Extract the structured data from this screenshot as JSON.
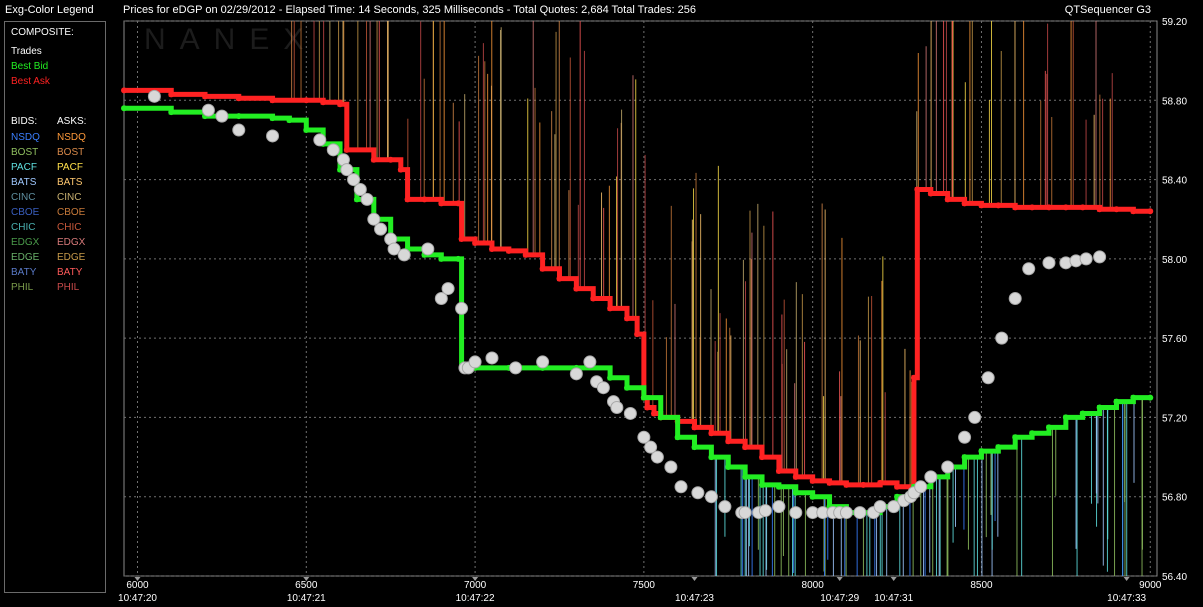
{
  "header": {
    "legend_title": "Exg-Color Legend",
    "chart_title": "Prices for  eDGP  on  02/29/2012  -  Elapsed Time: 14 Seconds, 325 Milliseconds  -  Total Quotes: 2,684  Total Trades: 256",
    "app_name": "QTSequencer G3"
  },
  "legend": {
    "composite_label": "COMPOSITE:",
    "composite": [
      {
        "label": "Trades",
        "color": "#ffffff"
      },
      {
        "label": "Best Bid",
        "color": "#22ee22"
      },
      {
        "label": "Best Ask",
        "color": "#ff2222"
      }
    ],
    "bids_label": "BIDS:",
    "asks_label": "ASKS:",
    "exchanges": [
      {
        "name": "NSDQ",
        "bid_color": "#3a7fff",
        "ask_color": "#ff9a3a"
      },
      {
        "name": "BOST",
        "bid_color": "#8fbf5f",
        "ask_color": "#d98a4a"
      },
      {
        "name": "PACF",
        "bid_color": "#5fe0e0",
        "ask_color": "#ffe04a"
      },
      {
        "name": "BATS",
        "bid_color": "#9fc8ff",
        "ask_color": "#ffc870"
      },
      {
        "name": "CINC",
        "bid_color": "#5f8fa0",
        "ask_color": "#c8b070"
      },
      {
        "name": "CBOE",
        "bid_color": "#3a5fc0",
        "ask_color": "#c87a3a"
      },
      {
        "name": "CHIC",
        "bid_color": "#4ab0b0",
        "ask_color": "#c8583a"
      },
      {
        "name": "EDGX",
        "bid_color": "#4a9a4a",
        "ask_color": "#d87a7a"
      },
      {
        "name": "EDGE",
        "bid_color": "#6ab06a",
        "ask_color": "#c89a4a"
      },
      {
        "name": "BATY",
        "bid_color": "#5a7ac8",
        "ask_color": "#ff5a5a"
      },
      {
        "name": "PHIL",
        "bid_color": "#7a9a4a",
        "ask_color": "#c84a4a"
      }
    ]
  },
  "watermark": "NANEX",
  "colors": {
    "background": "#000000",
    "grid": "#707070",
    "frame": "#8a8a8a",
    "trades": "#d8d8d8",
    "best_bid": "#22ee22",
    "best_ask": "#ff2222"
  },
  "chart_data": {
    "type": "line",
    "ylim": [
      56.4,
      59.2
    ],
    "y_ticks": [
      "59.20",
      "58.80",
      "58.40",
      "58.00",
      "57.60",
      "57.20",
      "56.80",
      "56.40"
    ],
    "xlim": [
      5960,
      9020
    ],
    "x_ticks": [
      "6000",
      "6500",
      "7000",
      "7500",
      "8000",
      "8500",
      "9000"
    ],
    "time_labels": [
      {
        "seq": 6000,
        "label": "10:47:20"
      },
      {
        "seq": 6500,
        "label": "10:47:21"
      },
      {
        "seq": 7000,
        "label": "10:47:22"
      },
      {
        "seq": 7650,
        "label": "10:47:23"
      },
      {
        "seq": 8080,
        "label": "10:47:29"
      },
      {
        "seq": 8240,
        "label": "10:47:31"
      },
      {
        "seq": 8930,
        "label": "10:47:33"
      }
    ],
    "series": [
      {
        "name": "Best Ask",
        "x": [
          5960,
          6100,
          6200,
          6300,
          6400,
          6500,
          6550,
          6600,
          6620,
          6700,
          6750,
          6780,
          6800,
          6850,
          6900,
          6950,
          6960,
          7000,
          7050,
          7100,
          7150,
          7200,
          7250,
          7300,
          7350,
          7400,
          7450,
          7480,
          7500,
          7510,
          7530,
          7550,
          7600,
          7650,
          7700,
          7750,
          7800,
          7850,
          7900,
          7950,
          8000,
          8050,
          8100,
          8150,
          8200,
          8250,
          8300,
          8310,
          8350,
          8400,
          8450,
          8500,
          8550,
          8600,
          8650,
          8700,
          8750,
          8800,
          8850,
          8900,
          8950,
          9000
        ],
        "y": [
          58.85,
          58.83,
          58.82,
          58.81,
          58.8,
          58.8,
          58.79,
          58.78,
          58.55,
          58.5,
          58.5,
          58.45,
          58.3,
          58.3,
          58.28,
          58.28,
          58.1,
          58.08,
          58.05,
          58.04,
          58.02,
          57.95,
          57.9,
          57.85,
          57.8,
          57.75,
          57.7,
          57.62,
          57.3,
          57.25,
          57.22,
          57.2,
          57.18,
          57.15,
          57.12,
          57.08,
          57.05,
          57.0,
          56.93,
          56.9,
          56.88,
          56.87,
          56.86,
          56.86,
          56.87,
          56.85,
          57.4,
          58.35,
          58.33,
          58.3,
          58.28,
          58.27,
          58.27,
          58.26,
          58.26,
          58.26,
          58.26,
          58.26,
          58.25,
          58.25,
          58.24,
          58.24
        ]
      },
      {
        "name": "Best Bid",
        "x": [
          5960,
          6100,
          6200,
          6300,
          6400,
          6450,
          6500,
          6550,
          6600,
          6650,
          6700,
          6750,
          6800,
          6850,
          6900,
          6950,
          6960,
          7000,
          7100,
          7200,
          7300,
          7400,
          7450,
          7500,
          7550,
          7600,
          7650,
          7700,
          7750,
          7800,
          7850,
          7900,
          7950,
          8000,
          8050,
          8100,
          8150,
          8200,
          8250,
          8300,
          8350,
          8400,
          8450,
          8500,
          8550,
          8600,
          8650,
          8700,
          8750,
          8800,
          8850,
          8900,
          8950,
          9000
        ],
        "y": [
          58.76,
          58.74,
          58.72,
          58.72,
          58.71,
          58.7,
          58.65,
          58.58,
          58.45,
          58.3,
          58.2,
          58.1,
          58.05,
          58.02,
          58.0,
          58.0,
          57.45,
          57.45,
          57.45,
          57.45,
          57.45,
          57.4,
          57.35,
          57.3,
          57.2,
          57.1,
          57.05,
          57.0,
          56.95,
          56.9,
          56.86,
          56.85,
          56.82,
          56.8,
          56.75,
          56.72,
          56.72,
          56.75,
          56.8,
          56.85,
          56.9,
          56.95,
          57.0,
          57.03,
          57.05,
          57.1,
          57.12,
          57.15,
          57.2,
          57.22,
          57.25,
          57.28,
          57.3,
          57.3
        ]
      },
      {
        "name": "Trades",
        "x": [
          6050,
          6210,
          6250,
          6300,
          6400,
          6540,
          6580,
          6610,
          6620,
          6640,
          6660,
          6680,
          6700,
          6720,
          6750,
          6760,
          6790,
          6860,
          6900,
          6920,
          6960,
          6970,
          6980,
          7000,
          7050,
          7120,
          7200,
          7300,
          7340,
          7360,
          7380,
          7410,
          7420,
          7460,
          7500,
          7520,
          7540,
          7580,
          7610,
          7660,
          7700,
          7740,
          7790,
          7800,
          7840,
          7860,
          7900,
          7950,
          8000,
          8030,
          8060,
          8080,
          8100,
          8140,
          8180,
          8200,
          8240,
          8270,
          8290,
          8300,
          8320,
          8350,
          8400,
          8450,
          8480,
          8520,
          8560,
          8600,
          8640,
          8700,
          8750,
          8780,
          8810,
          8850
        ],
        "y": [
          58.82,
          58.75,
          58.72,
          58.65,
          58.62,
          58.6,
          58.55,
          58.5,
          58.45,
          58.4,
          58.35,
          58.3,
          58.2,
          58.15,
          58.1,
          58.05,
          58.02,
          58.05,
          57.8,
          57.85,
          57.75,
          57.45,
          57.45,
          57.48,
          57.5,
          57.45,
          57.48,
          57.42,
          57.48,
          57.38,
          57.35,
          57.28,
          57.25,
          57.22,
          57.1,
          57.05,
          57.0,
          56.95,
          56.85,
          56.82,
          56.8,
          56.75,
          56.72,
          56.72,
          56.72,
          56.73,
          56.75,
          56.72,
          56.72,
          56.72,
          56.72,
          56.72,
          56.72,
          56.72,
          56.72,
          56.75,
          56.75,
          56.78,
          56.8,
          56.82,
          56.85,
          56.9,
          56.95,
          57.1,
          57.2,
          57.4,
          57.6,
          57.8,
          57.95,
          57.98,
          57.98,
          57.99,
          58.0,
          58.01
        ]
      }
    ]
  }
}
